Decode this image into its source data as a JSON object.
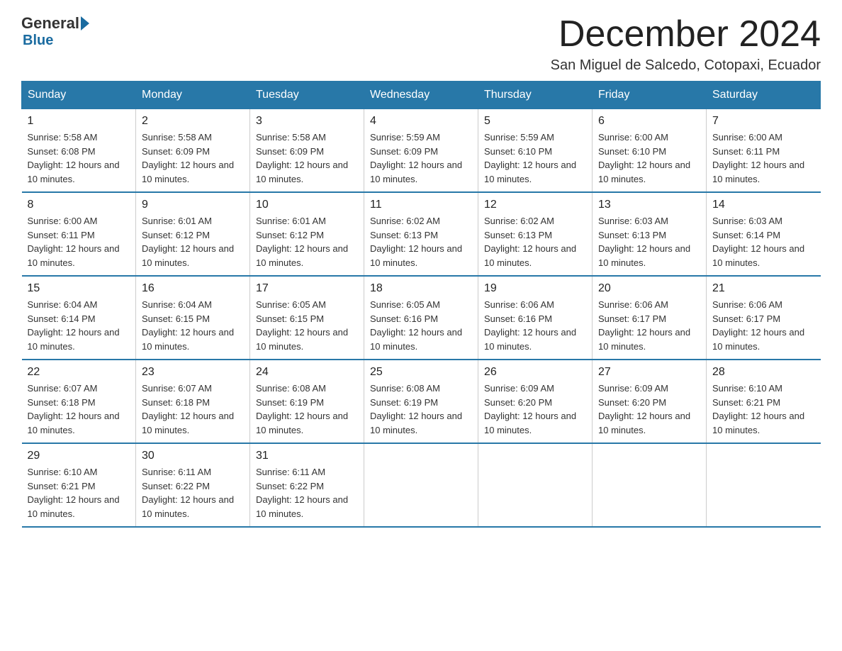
{
  "logo": {
    "general": "General",
    "blue": "Blue"
  },
  "header": {
    "title": "December 2024",
    "subtitle": "San Miguel de Salcedo, Cotopaxi, Ecuador"
  },
  "weekdays": [
    "Sunday",
    "Monday",
    "Tuesday",
    "Wednesday",
    "Thursday",
    "Friday",
    "Saturday"
  ],
  "weeks": [
    [
      {
        "day": "1",
        "sunrise": "5:58 AM",
        "sunset": "6:08 PM",
        "daylight": "12 hours and 10 minutes."
      },
      {
        "day": "2",
        "sunrise": "5:58 AM",
        "sunset": "6:09 PM",
        "daylight": "12 hours and 10 minutes."
      },
      {
        "day": "3",
        "sunrise": "5:58 AM",
        "sunset": "6:09 PM",
        "daylight": "12 hours and 10 minutes."
      },
      {
        "day": "4",
        "sunrise": "5:59 AM",
        "sunset": "6:09 PM",
        "daylight": "12 hours and 10 minutes."
      },
      {
        "day": "5",
        "sunrise": "5:59 AM",
        "sunset": "6:10 PM",
        "daylight": "12 hours and 10 minutes."
      },
      {
        "day": "6",
        "sunrise": "6:00 AM",
        "sunset": "6:10 PM",
        "daylight": "12 hours and 10 minutes."
      },
      {
        "day": "7",
        "sunrise": "6:00 AM",
        "sunset": "6:11 PM",
        "daylight": "12 hours and 10 minutes."
      }
    ],
    [
      {
        "day": "8",
        "sunrise": "6:00 AM",
        "sunset": "6:11 PM",
        "daylight": "12 hours and 10 minutes."
      },
      {
        "day": "9",
        "sunrise": "6:01 AM",
        "sunset": "6:12 PM",
        "daylight": "12 hours and 10 minutes."
      },
      {
        "day": "10",
        "sunrise": "6:01 AM",
        "sunset": "6:12 PM",
        "daylight": "12 hours and 10 minutes."
      },
      {
        "day": "11",
        "sunrise": "6:02 AM",
        "sunset": "6:13 PM",
        "daylight": "12 hours and 10 minutes."
      },
      {
        "day": "12",
        "sunrise": "6:02 AM",
        "sunset": "6:13 PM",
        "daylight": "12 hours and 10 minutes."
      },
      {
        "day": "13",
        "sunrise": "6:03 AM",
        "sunset": "6:13 PM",
        "daylight": "12 hours and 10 minutes."
      },
      {
        "day": "14",
        "sunrise": "6:03 AM",
        "sunset": "6:14 PM",
        "daylight": "12 hours and 10 minutes."
      }
    ],
    [
      {
        "day": "15",
        "sunrise": "6:04 AM",
        "sunset": "6:14 PM",
        "daylight": "12 hours and 10 minutes."
      },
      {
        "day": "16",
        "sunrise": "6:04 AM",
        "sunset": "6:15 PM",
        "daylight": "12 hours and 10 minutes."
      },
      {
        "day": "17",
        "sunrise": "6:05 AM",
        "sunset": "6:15 PM",
        "daylight": "12 hours and 10 minutes."
      },
      {
        "day": "18",
        "sunrise": "6:05 AM",
        "sunset": "6:16 PM",
        "daylight": "12 hours and 10 minutes."
      },
      {
        "day": "19",
        "sunrise": "6:06 AM",
        "sunset": "6:16 PM",
        "daylight": "12 hours and 10 minutes."
      },
      {
        "day": "20",
        "sunrise": "6:06 AM",
        "sunset": "6:17 PM",
        "daylight": "12 hours and 10 minutes."
      },
      {
        "day": "21",
        "sunrise": "6:06 AM",
        "sunset": "6:17 PM",
        "daylight": "12 hours and 10 minutes."
      }
    ],
    [
      {
        "day": "22",
        "sunrise": "6:07 AM",
        "sunset": "6:18 PM",
        "daylight": "12 hours and 10 minutes."
      },
      {
        "day": "23",
        "sunrise": "6:07 AM",
        "sunset": "6:18 PM",
        "daylight": "12 hours and 10 minutes."
      },
      {
        "day": "24",
        "sunrise": "6:08 AM",
        "sunset": "6:19 PM",
        "daylight": "12 hours and 10 minutes."
      },
      {
        "day": "25",
        "sunrise": "6:08 AM",
        "sunset": "6:19 PM",
        "daylight": "12 hours and 10 minutes."
      },
      {
        "day": "26",
        "sunrise": "6:09 AM",
        "sunset": "6:20 PM",
        "daylight": "12 hours and 10 minutes."
      },
      {
        "day": "27",
        "sunrise": "6:09 AM",
        "sunset": "6:20 PM",
        "daylight": "12 hours and 10 minutes."
      },
      {
        "day": "28",
        "sunrise": "6:10 AM",
        "sunset": "6:21 PM",
        "daylight": "12 hours and 10 minutes."
      }
    ],
    [
      {
        "day": "29",
        "sunrise": "6:10 AM",
        "sunset": "6:21 PM",
        "daylight": "12 hours and 10 minutes."
      },
      {
        "day": "30",
        "sunrise": "6:11 AM",
        "sunset": "6:22 PM",
        "daylight": "12 hours and 10 minutes."
      },
      {
        "day": "31",
        "sunrise": "6:11 AM",
        "sunset": "6:22 PM",
        "daylight": "12 hours and 10 minutes."
      },
      null,
      null,
      null,
      null
    ]
  ],
  "labels": {
    "sunrise": "Sunrise:",
    "sunset": "Sunset:",
    "daylight": "Daylight:"
  }
}
